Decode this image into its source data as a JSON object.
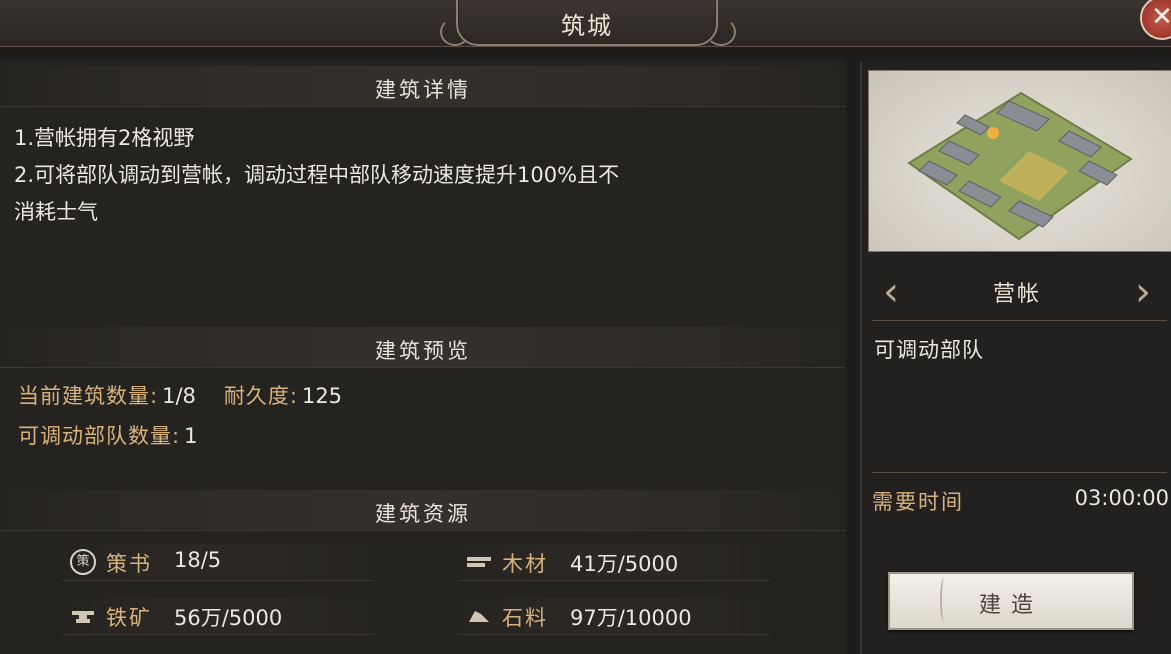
{
  "window": {
    "title": "筑城",
    "close_label": "✕"
  },
  "detail": {
    "header": "建筑详情",
    "line1": "1.营帐拥有2格视野",
    "line2": "2.可将部队调动到营帐，调动过程中部队移动速度提升100%且不",
    "line3": "消耗士气"
  },
  "preview": {
    "header": "建筑预览",
    "count_label": "当前建筑数量:",
    "count_value": "1/8",
    "durability_label": "耐久度:",
    "durability_value": "125",
    "troops_label": "可调动部队数量:",
    "troops_value": "1"
  },
  "resources": {
    "header": "建筑资源",
    "items": [
      {
        "icon": "strategy-book-icon",
        "name": "策书",
        "value": "18/5"
      },
      {
        "icon": "wood-icon",
        "name": "木材",
        "value": "41万/5000"
      },
      {
        "icon": "iron-anvil-icon",
        "name": "铁矿",
        "value": "56万/5000"
      },
      {
        "icon": "stone-icon",
        "name": "石料",
        "value": "97万/10000"
      }
    ],
    "book_icon_char": "策"
  },
  "side": {
    "building_name": "营帐",
    "description": "可调动部队",
    "time_label": "需要时间",
    "time_value": "03:00:00",
    "build_button": "建造",
    "prev_arrow": "‹",
    "next_arrow": "›"
  },
  "colors": {
    "accent_gold": "#d8b27d",
    "text_light": "#ece8e1",
    "close_red": "#a8372c"
  }
}
